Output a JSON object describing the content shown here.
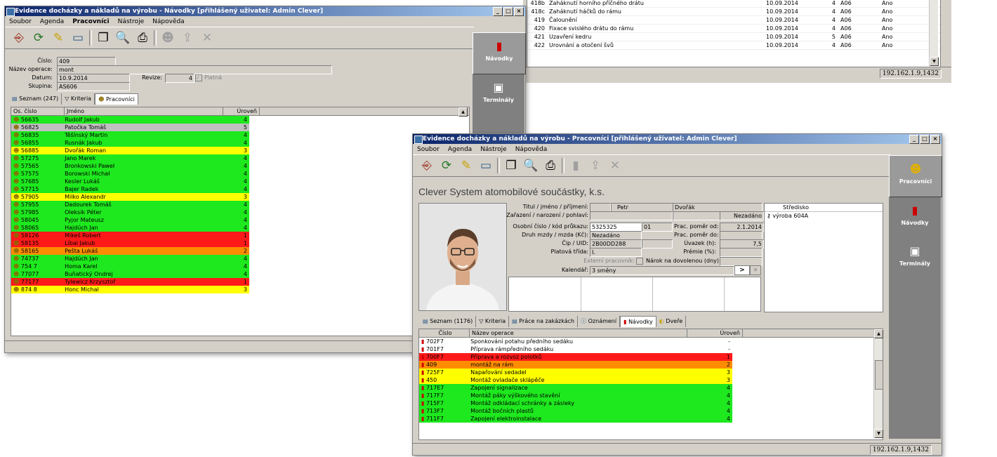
{
  "bg_window": {
    "rows": [
      {
        "id": "418b",
        "name": "Zaháknutí horního příčného drátu",
        "date": "10.09.2014",
        "lvl": "4",
        "grp": "A06",
        "active": "Ano"
      },
      {
        "id": "418c",
        "name": "Zaháknutí háčků do rámu",
        "date": "10.09.2014",
        "lvl": "4",
        "grp": "A06",
        "active": "Ano"
      },
      {
        "id": "419",
        "name": "Čalounění",
        "date": "10.09.2014",
        "lvl": "4",
        "grp": "A06",
        "active": "Ano"
      },
      {
        "id": "420",
        "name": "Fixace svislého drátu do rámu",
        "date": "10.09.2014",
        "lvl": "4",
        "grp": "A06",
        "active": "Ano"
      },
      {
        "id": "421",
        "name": "Uzavření kedru",
        "date": "10.09.2014",
        "lvl": "5",
        "grp": "A06",
        "active": "Ano"
      },
      {
        "id": "422",
        "name": "Urovnání a otočení švů",
        "date": "10.09.2014",
        "lvl": "4",
        "grp": "A06",
        "active": "Ano"
      }
    ],
    "status": "192.162.1.9,1432"
  },
  "win1": {
    "title": "Evidence docházky a nákladů na výrobu - Návodky [přihlášený uživatel: Admin Clever]",
    "menu": [
      "Soubor",
      "Agenda",
      "Pracovníci",
      "Nástroje",
      "Nápověda"
    ],
    "form": {
      "cislo_label": "Číslo:",
      "cislo": "409",
      "nazev_label": "Název operace:",
      "nazev": "mont",
      "datum_label": "Datum:",
      "datum": "10.9.2014",
      "revize_label": "Revize:",
      "revize": "4",
      "platna_label": "Platná",
      "skupina_label": "Skupina:",
      "skupina": "AS606"
    },
    "tabs": [
      "Seznam (247)",
      "Kriteria",
      "Pracovníci"
    ],
    "columns": [
      "Os. číslo",
      "Jméno",
      "Úroveň"
    ],
    "rows": [
      {
        "id": "56635",
        "name": "Rudolf Jakub",
        "lvl": "4",
        "c": "g"
      },
      {
        "id": "56825",
        "name": "Patočka Tomáš",
        "lvl": "5",
        "c": "gr"
      },
      {
        "id": "56835",
        "name": "Těšínský Martin",
        "lvl": "4",
        "c": "g"
      },
      {
        "id": "56855",
        "name": "Rusnák Jakub",
        "lvl": "4",
        "c": "g"
      },
      {
        "id": "56885",
        "name": "Dvořák Roman",
        "lvl": "3",
        "c": "y"
      },
      {
        "id": "57275",
        "name": "Jano Marek",
        "lvl": "4",
        "c": "g"
      },
      {
        "id": "57565",
        "name": "Bronkowski Paweł",
        "lvl": "4",
        "c": "g"
      },
      {
        "id": "57575",
        "name": "Borowski Michał",
        "lvl": "4",
        "c": "g"
      },
      {
        "id": "57685",
        "name": "Kesler Lukáš",
        "lvl": "4",
        "c": "g"
      },
      {
        "id": "57715",
        "name": "Bajer Radek",
        "lvl": "4",
        "c": "g"
      },
      {
        "id": "57905",
        "name": "Milko Alexandr",
        "lvl": "3",
        "c": "y"
      },
      {
        "id": "57955",
        "name": "Dadourek Tomáš",
        "lvl": "4",
        "c": "g"
      },
      {
        "id": "57985",
        "name": "Oleksik Péter",
        "lvl": "4",
        "c": "g"
      },
      {
        "id": "58045",
        "name": "Pyjor Mateusz",
        "lvl": "4",
        "c": "g"
      },
      {
        "id": "58065",
        "name": "Hajdúch Jan",
        "lvl": "4",
        "c": "g"
      },
      {
        "id": "58126",
        "name": "Mikeš Robert",
        "lvl": "1",
        "c": "r"
      },
      {
        "id": "58135",
        "name": "Líbal Jakub",
        "lvl": "1",
        "c": "r"
      },
      {
        "id": "58165",
        "name": "Pešta Lukáš",
        "lvl": "2",
        "c": "o"
      },
      {
        "id": "74737",
        "name": "Hajdúch Jan",
        "lvl": "4",
        "c": "g"
      },
      {
        "id": "754 7",
        "name": "Homa Karel",
        "lvl": "4",
        "c": "g"
      },
      {
        "id": "77077",
        "name": "Buňatický Ondrej",
        "lvl": "4",
        "c": "g"
      },
      {
        "id": "77177",
        "name": "Tylewicz Krzysztof",
        "lvl": "1",
        "c": "r"
      },
      {
        "id": "874 8",
        "name": "Honc Michal",
        "lvl": "3",
        "c": "y"
      }
    ],
    "side": [
      "Návodky",
      "Terminály"
    ]
  },
  "win2": {
    "title": "Evidence docházky a nákladů na výrobu - Pracovníci [přihlášený uživatel: Admin Clever]",
    "menu": [
      "Soubor",
      "Agenda",
      "Nástroje",
      "Nápověda"
    ],
    "company": "Clever System atomobilové součástky, k.s.",
    "form": {
      "titul_label": "Titul / jméno / příjmení:",
      "jmeno": "Petr",
      "prijmeni": "Dvořák",
      "zarazeni_label": "Zařazení / narození / pohlaví:",
      "pohlavi": "Nezadáno",
      "oscislo_label": "Osobní číslo / kód průkazu:",
      "oscislo": "5325325",
      "kod": "01",
      "pomer_od_label": "Prac. poměr od:",
      "pomer_od": "2.1.2014",
      "druh_label": "Druh mzdy / mzda (Kč):",
      "druh": "Nezadáno",
      "pomer_do_label": "Prac. poměr do:",
      "cip_label": "Čip / UID:",
      "cip": "2B00DD288",
      "uvazek_label": "Úvazek (h):",
      "uvazek": "7,5",
      "trida_label": "Platová třída:",
      "trida": "I.",
      "premie_label": "Prémie (%):",
      "externi_label": "Externí pracovník:",
      "narok_label": "Nárok na dovolenou (dny):",
      "kalendar_label": "Kalendář:",
      "kalendar": "3 směny"
    },
    "stredisko_head": "Středisko",
    "stredisko": "výroba 604A",
    "tabs": [
      "Seznam (1176)",
      "Kriteria",
      "Práce na zakázkách",
      "Oznámení",
      "Návodky",
      "Dveře"
    ],
    "columns": [
      "Číslo",
      "Název operace",
      "Úroveň"
    ],
    "rows": [
      {
        "id": "702F7",
        "name": "Sponkování potahu předního sedáku",
        "lvl": "-",
        "c": ""
      },
      {
        "id": "701F7",
        "name": "Příprava rámpředního sedáku",
        "lvl": "-",
        "c": ""
      },
      {
        "id": "700F7",
        "name": "Příprava a rozvoz polotků",
        "lvl": "1",
        "c": "r"
      },
      {
        "id": "409",
        "name": "montáž na rám",
        "lvl": "2",
        "c": "o"
      },
      {
        "id": "725F7",
        "name": "Napařování sedadel",
        "lvl": "3",
        "c": "y"
      },
      {
        "id": "450",
        "name": "Montáž ovladače sklápěče",
        "lvl": "3",
        "c": "y"
      },
      {
        "id": "717E7",
        "name": "Zapojení signalizace",
        "lvl": "4",
        "c": "g"
      },
      {
        "id": "717F7",
        "name": "Montáž páky výškového stavění",
        "lvl": "4",
        "c": "g"
      },
      {
        "id": "715F7",
        "name": "Montáž odkládací schránky a zásleky",
        "lvl": "4",
        "c": "g"
      },
      {
        "id": "713F7",
        "name": "Montáž bočních plastů",
        "lvl": "4",
        "c": "g"
      },
      {
        "id": "711F7",
        "name": "Zapojení elektroinstalace",
        "lvl": "4",
        "c": "g"
      }
    ],
    "side": [
      "Pracovníci",
      "Návodky",
      "Terminály"
    ],
    "status": "192.162.1.9,1432"
  },
  "icons": [
    "exit-icon",
    "refresh-icon",
    "edit-icon",
    "monitor-icon",
    "folder-icon",
    "print-preview-icon",
    "print-icon",
    "users-icon",
    "export-icon",
    "close-icon"
  ]
}
